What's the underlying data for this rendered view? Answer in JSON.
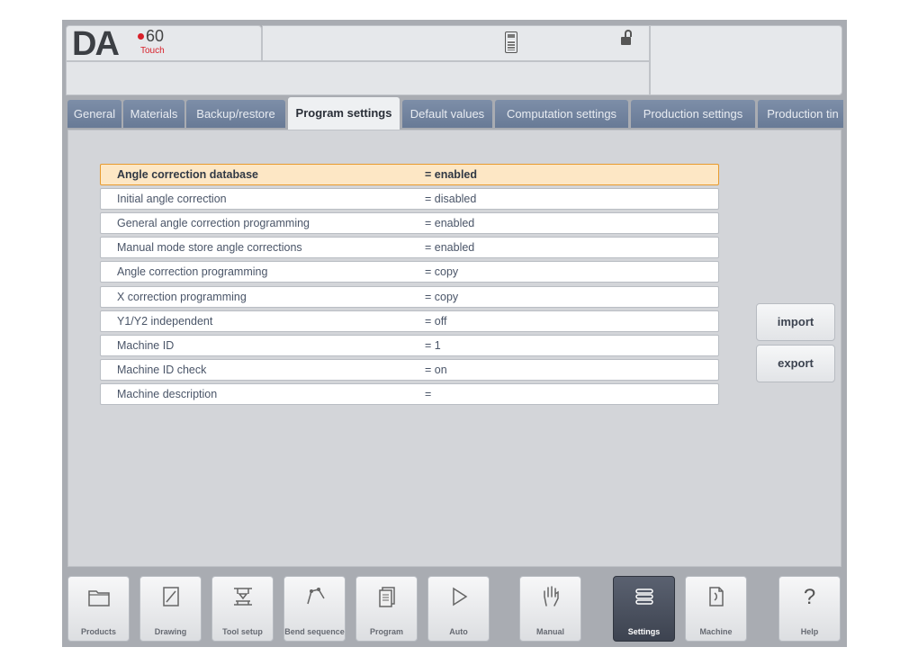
{
  "logo": {
    "brand": "DA",
    "model": "60",
    "edition": "Touch"
  },
  "tabs": [
    {
      "label": "General"
    },
    {
      "label": "Materials"
    },
    {
      "label": "Backup/restore"
    },
    {
      "label": "Program settings",
      "active": true
    },
    {
      "label": "Default values"
    },
    {
      "label": "Computation settings"
    },
    {
      "label": "Production settings"
    },
    {
      "label": "Production tin"
    }
  ],
  "settings": [
    {
      "label": "Angle correction database",
      "value": "= enabled",
      "selected": true
    },
    {
      "label": "Initial angle correction",
      "value": "= disabled"
    },
    {
      "label": "General angle correction programming",
      "value": "= enabled"
    },
    {
      "label": "Manual mode store angle corrections",
      "value": "= enabled"
    },
    {
      "label": "Angle correction programming",
      "value": "= copy"
    },
    {
      "label": "X correction programming",
      "value": "= copy"
    },
    {
      "label": "Y1/Y2 independent",
      "value": "= off"
    },
    {
      "label": "Machine ID",
      "value": "= 1"
    },
    {
      "label": "Machine ID check",
      "value": "= on"
    },
    {
      "label": "Machine description",
      "value": "="
    }
  ],
  "actions": {
    "import_label": "import",
    "export_label": "export"
  },
  "nav": [
    {
      "label": "Products",
      "icon": "folder-icon"
    },
    {
      "label": "Drawing",
      "icon": "drawing-icon"
    },
    {
      "label": "Tool setup",
      "icon": "tool-setup-icon"
    },
    {
      "label": "Bend sequence",
      "icon": "bend-sequence-icon"
    },
    {
      "label": "Program",
      "icon": "program-icon"
    },
    {
      "label": "Auto",
      "icon": "play-icon"
    },
    {
      "label": "Manual",
      "icon": "hand-icon"
    },
    {
      "label": "Settings",
      "icon": "settings-list-icon",
      "active": true
    },
    {
      "label": "Machine",
      "icon": "machine-icon"
    },
    {
      "label": "Help",
      "icon": "help-icon",
      "glyph": "?"
    }
  ],
  "colors": {
    "accent_selected": "#e79a2e",
    "tab_inactive": "#687a96",
    "nav_active": "#3d4350"
  }
}
